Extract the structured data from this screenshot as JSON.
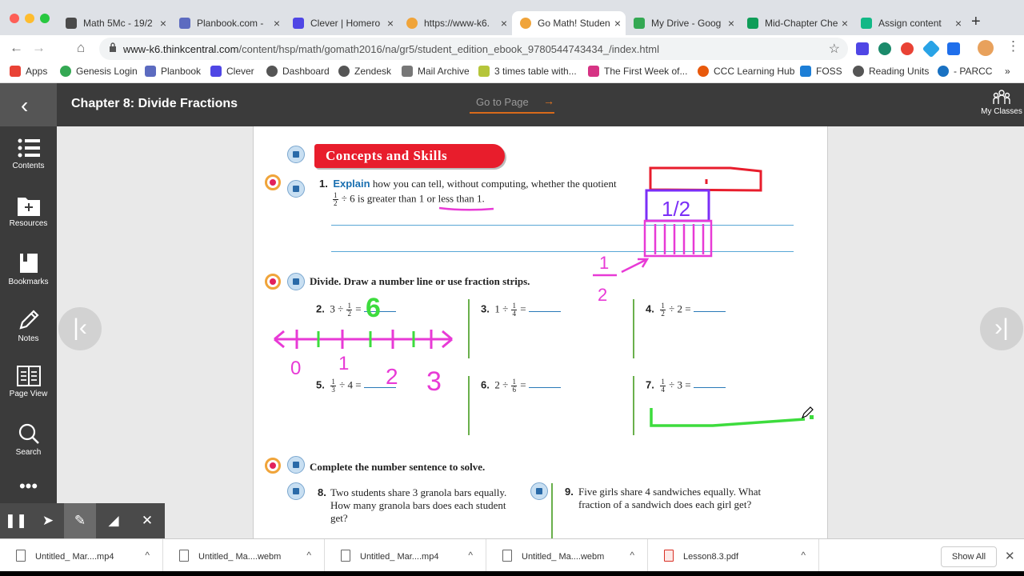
{
  "browser": {
    "tabs": [
      {
        "title": "Math 5Mc - 19/2",
        "color": "#4a4a4a"
      },
      {
        "title": "Planbook.com -",
        "color": "#5c6bc0"
      },
      {
        "title": "Clever | Homero",
        "color": "#4f46e5"
      },
      {
        "title": "https://www-k6.",
        "color": "#f0a43a"
      },
      {
        "title": "Go Math! Studen",
        "color": "#f0a43a"
      },
      {
        "title": "My Drive - Goog",
        "color": "#34a853"
      },
      {
        "title": "Mid-Chapter Che",
        "color": "#0f9d58"
      },
      {
        "title": "Assign content",
        "color": "#12b886"
      }
    ],
    "url_host": "www-k6.thinkcentral.com",
    "url_path": "/content/hsp/math/gomath2016/na/gr5/student_edition_ebook_9780544743434_/index.html",
    "bookmarks": [
      {
        "label": "Apps",
        "color": "#e94235"
      },
      {
        "label": "Genesis Login",
        "color": "#34a853"
      },
      {
        "label": "Planbook",
        "color": "#5c6bc0"
      },
      {
        "label": "Clever",
        "color": "#4f46e5"
      },
      {
        "label": "Dashboard",
        "color": "#555555"
      },
      {
        "label": "Zendesk",
        "color": "#555555"
      },
      {
        "label": "Mail Archive",
        "color": "#777777"
      },
      {
        "label": "3 times table with...",
        "color": "#b5c53a"
      },
      {
        "label": "The First Week of...",
        "color": "#d63384"
      },
      {
        "label": "CCC Learning Hub",
        "color": "#e8590c"
      },
      {
        "label": "FOSS",
        "color": "#1c7ed6"
      },
      {
        "label": "Reading Units",
        "color": "#555555"
      },
      {
        "label": "- PARCC",
        "color": "#1971c2"
      }
    ]
  },
  "app": {
    "chapter_title": "Chapter 8: Divide Fractions",
    "goto_label": "Go to Page",
    "my_classes": "My Classes",
    "sidebar": [
      "Contents",
      "Resources",
      "Bookmarks",
      "Notes",
      "Page View",
      "Search"
    ]
  },
  "page": {
    "section_title": "Concepts and Skills",
    "q1_label": "Explain",
    "q1_text1": "how you can tell, without computing, whether the quotient",
    "q1_text2": "÷ 6 is greater than 1 or less than 1.",
    "divide_instr": "Divide. Draw a number line or use fraction strips.",
    "problems": [
      {
        "num": "2.",
        "lead": "3 ÷",
        "fn": "1",
        "fd": "2",
        "tail": "="
      },
      {
        "num": "3.",
        "lead": "1 ÷",
        "fn": "1",
        "fd": "4",
        "tail": "="
      },
      {
        "num": "4.",
        "lead": "",
        "fn": "1",
        "fd": "2",
        "tail": "÷ 2 ="
      },
      {
        "num": "5.",
        "lead": "",
        "fn": "1",
        "fd": "3",
        "tail": "÷ 4 ="
      },
      {
        "num": "6.",
        "lead": "2 ÷",
        "fn": "1",
        "fd": "6",
        "tail": "="
      },
      {
        "num": "7.",
        "lead": "",
        "fn": "1",
        "fd": "4",
        "tail": "÷ 3 ="
      }
    ],
    "complete_instr": "Complete the number sentence to solve.",
    "q8_num": "8.",
    "q8_text": "Two students share 3 granola bars equally. How many granola bars does each student get?",
    "q9_num": "9.",
    "q9_text": "Five girls share 4 sandwiches equally. What fraction of a sandwich does each girl get?",
    "handwriting": {
      "answer2": "6",
      "nl_labels": [
        "0",
        "1",
        "2",
        "3"
      ],
      "frac_strip": "1/2",
      "frac_note_n": "1",
      "frac_note_d": "2"
    }
  },
  "downloads": [
    {
      "name": "Untitled_ Mar....mp4",
      "type": "video"
    },
    {
      "name": "Untitled_ Ma....webm",
      "type": "video"
    },
    {
      "name": "Untitled_ Mar....mp4",
      "type": "video"
    },
    {
      "name": "Untitled_ Ma....webm",
      "type": "video"
    },
    {
      "name": "Lesson8.3.pdf",
      "type": "pdf"
    }
  ],
  "show_all": "Show All",
  "colors": {
    "accent": "#e87722",
    "banner": "#e81d2c",
    "ink_magenta": "#e83ad6",
    "ink_green": "#3ddc3d",
    "ink_red": "#e81d2c",
    "ink_purple": "#7b2ff7"
  }
}
